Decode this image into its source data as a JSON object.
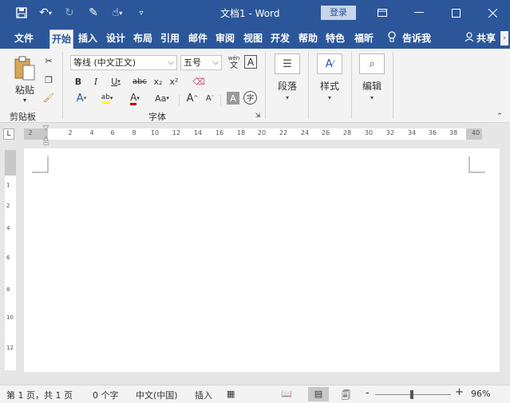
{
  "window": {
    "title": "文档1 - Word",
    "login": "登录",
    "quick_access": [
      "save-icon",
      "undo-icon",
      "redo-icon",
      "format-painter-icon",
      "touch-mode-icon",
      "customize-icon"
    ]
  },
  "tabs": [
    {
      "label": "文件"
    },
    {
      "label": "开始"
    },
    {
      "label": "插入"
    },
    {
      "label": "设计"
    },
    {
      "label": "布局"
    },
    {
      "label": "引用"
    },
    {
      "label": "邮件"
    },
    {
      "label": "审阅"
    },
    {
      "label": "视图"
    },
    {
      "label": "开发"
    },
    {
      "label": "帮助"
    },
    {
      "label": "特色"
    },
    {
      "label": "福昕"
    }
  ],
  "tell_me": "告诉我",
  "share": "共享",
  "ribbon": {
    "clipboard": {
      "paste": "粘贴",
      "group": "剪贴板"
    },
    "font": {
      "font_name": "等线 (中文正文)",
      "font_size": "五号",
      "group": "字体",
      "bold": "B",
      "italic": "I",
      "underline": "U",
      "strike": "abc",
      "sub": "x₂",
      "sup": "x²",
      "grow": "A",
      "shrink": "A",
      "case": "Aa",
      "pinyin_top": "wén",
      "pinyin_bottom": "文",
      "char_border": "A",
      "char_shade": "A",
      "enclose": "字"
    },
    "paragraph": {
      "label": "段落"
    },
    "styles": {
      "label": "样式"
    },
    "editing": {
      "label": "编辑"
    }
  },
  "ruler": {
    "ticks": [
      "2",
      "2",
      "4",
      "6",
      "8",
      "10",
      "12",
      "14",
      "16",
      "18",
      "20",
      "22",
      "24",
      "26",
      "28",
      "30",
      "32",
      "34",
      "36",
      "38",
      "40"
    ],
    "vticks": [
      "1",
      "2",
      "4",
      "6",
      "8",
      "10",
      "12"
    ],
    "tab_selector": "L"
  },
  "status": {
    "page": "第 1 页，共 1 页",
    "words": "0 个字",
    "language": "中文(中国)",
    "mode": "插入",
    "zoom": "96%",
    "zoom_minus": "-",
    "zoom_plus": "+"
  },
  "colors": {
    "brand": "#2b579a",
    "highlight": "#ffff00",
    "font_color": "#c00000"
  }
}
